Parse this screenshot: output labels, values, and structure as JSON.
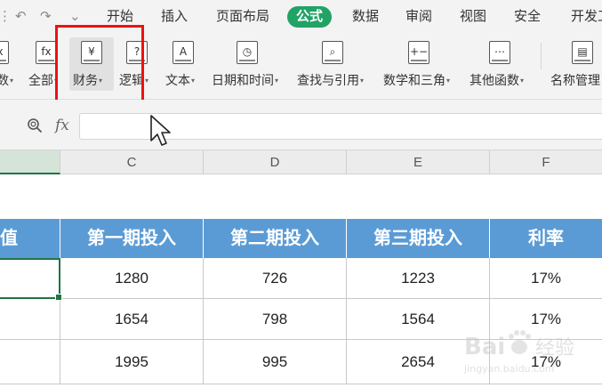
{
  "menubar": {
    "quick_access": [
      "⋮",
      "↶",
      "↷",
      "⌄"
    ],
    "tabs": [
      {
        "label": "开始",
        "active": false
      },
      {
        "label": "插入",
        "active": false
      },
      {
        "label": "页面布局",
        "active": false
      },
      {
        "label": "公式",
        "active": true
      },
      {
        "label": "数据",
        "active": false
      },
      {
        "label": "审阅",
        "active": false
      },
      {
        "label": "视图",
        "active": false
      },
      {
        "label": "安全",
        "active": false
      },
      {
        "label": "开发工",
        "active": false
      }
    ],
    "accent_color": "#21a366"
  },
  "ribbon": {
    "buttons": [
      {
        "label": "数",
        "icon": "insert-function-icon",
        "glyph": "fx"
      },
      {
        "label": "全部",
        "icon": "all-functions-icon",
        "glyph": "fx"
      },
      {
        "label": "财务",
        "icon": "finance-book-icon",
        "glyph": "¥"
      },
      {
        "label": "逻辑",
        "icon": "logic-book-icon",
        "glyph": "?"
      },
      {
        "label": "文本",
        "icon": "text-book-icon",
        "glyph": "A"
      },
      {
        "label": "日期和时间",
        "icon": "datetime-book-icon",
        "glyph": "◷"
      },
      {
        "label": "查找与引用",
        "icon": "lookup-book-icon",
        "glyph": "⌕"
      },
      {
        "label": "数学和三角",
        "icon": "math-book-icon",
        "glyph": "+−"
      },
      {
        "label": "其他函数",
        "icon": "other-functions-book-icon",
        "glyph": "⋯"
      },
      {
        "label": "名称管理",
        "icon": "name-manager-icon",
        "glyph": "▤"
      }
    ],
    "dropdown_arrow": "▾"
  },
  "formula_bar": {
    "fx_label": "fx",
    "value": ""
  },
  "columns": [
    {
      "letter": ""
    },
    {
      "letter": "C"
    },
    {
      "letter": "D"
    },
    {
      "letter": "E"
    },
    {
      "letter": "F"
    }
  ],
  "table": {
    "headers": [
      "值",
      "第一期投入",
      "第二期投入",
      "第三期投入",
      "利率"
    ],
    "rows": [
      [
        "",
        "1280",
        "726",
        "1223",
        "17%"
      ],
      [
        "",
        "1654",
        "798",
        "1564",
        "17%"
      ],
      [
        "",
        "1995",
        "995",
        "2654",
        "17%"
      ]
    ],
    "header_color": "#5b9bd5"
  },
  "watermark": {
    "brand": "Bai",
    "brand2": "经验",
    "url": "jingyan.baidu.com"
  },
  "annotation_color": "#ee1111"
}
